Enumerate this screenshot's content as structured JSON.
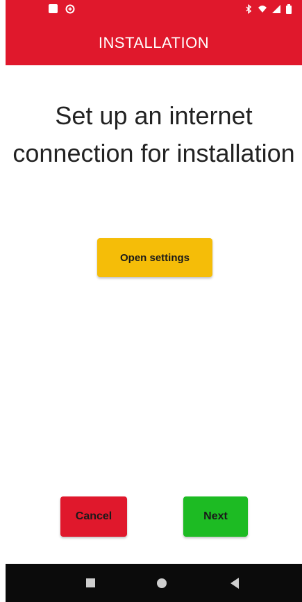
{
  "status_bar": {
    "left_icons": [
      "notification-square-icon",
      "app-notification-icon"
    ],
    "right_icons": [
      "bluetooth-icon",
      "wifi-icon",
      "signal-icon",
      "battery-icon"
    ]
  },
  "app_bar": {
    "title": "INSTALLATION"
  },
  "main": {
    "heading": "Set up an internet connection for installation",
    "open_settings_label": "Open settings"
  },
  "footer": {
    "cancel_label": "Cancel",
    "next_label": "Next"
  },
  "nav_bar": {
    "icons": [
      "recents-icon",
      "home-icon",
      "back-icon"
    ]
  },
  "colors": {
    "accent": "#e0182c",
    "settings_button": "#f5bd08",
    "cancel_button": "#e0182c",
    "next_button": "#1dbb23",
    "nav_bar": "#0b0b0b"
  }
}
